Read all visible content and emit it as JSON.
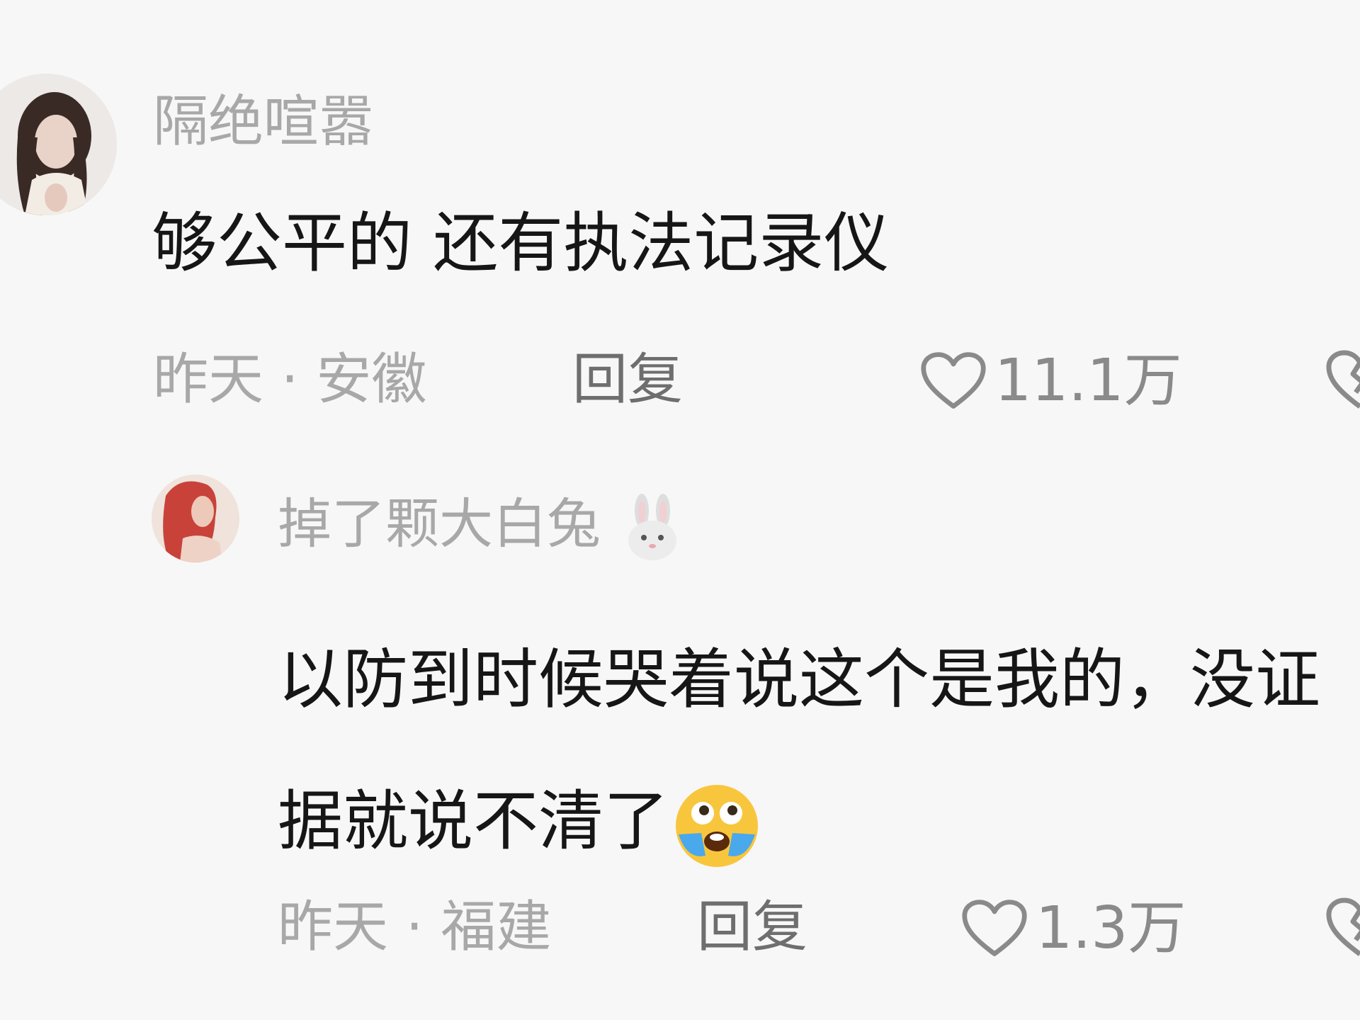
{
  "comments": [
    {
      "username": "隔绝喧嚣",
      "text": "够公平的 还有执法记录仪",
      "meta": "昨天 · 安徽",
      "reply_label": "回复",
      "likes": "11.1万",
      "avatar_icon": "user-avatar-woman-dark-hair"
    },
    {
      "username": "掉了颗大白兔",
      "username_emoji": "rabbit-face-icon",
      "text": "以防到时候哭着说这个是我的，没证据就说不清了",
      "text_emoji": "laughing-crying-emoji",
      "meta": "昨天 · 福建",
      "reply_label": "回复",
      "likes": "1.3万",
      "avatar_icon": "user-avatar-woman-red-hair"
    }
  ],
  "colors": {
    "background": "#f7f7f7",
    "text": "#161616",
    "secondary": "#a8a8a8",
    "reply": "#6e6e6e"
  }
}
